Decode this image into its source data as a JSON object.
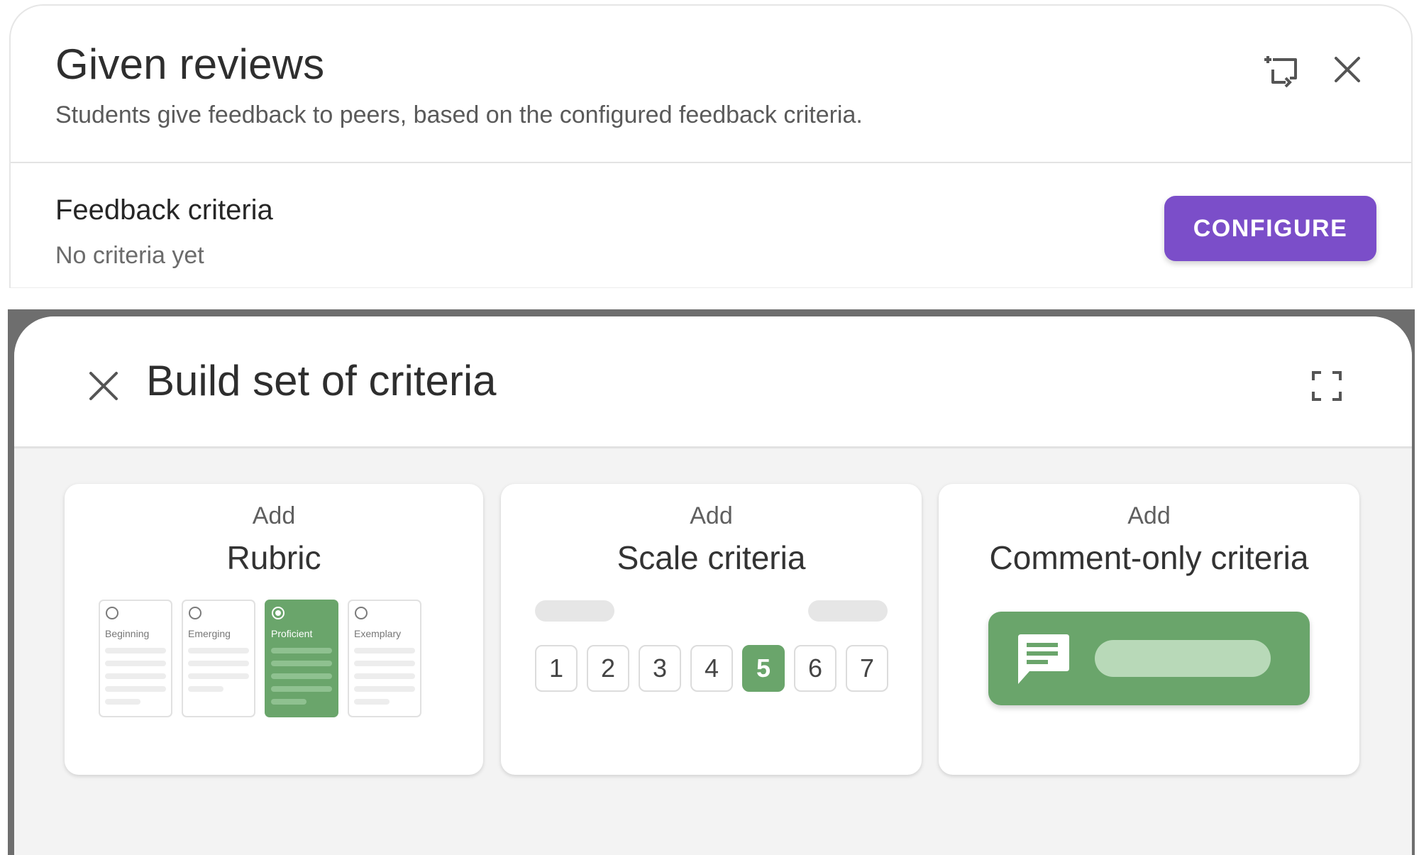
{
  "given_reviews": {
    "title": "Given reviews",
    "subtitle": "Students give feedback to peers, based on the configured feedback criteria.",
    "criteria_heading": "Feedback criteria",
    "criteria_status": "No criteria yet",
    "configure_label": "CONFIGURE",
    "icons": {
      "add_to": "add-to-icon",
      "close": "close-icon"
    },
    "colors": {
      "button": "#7b4ec9"
    }
  },
  "dialog": {
    "title": "Build set of criteria",
    "icons": {
      "close": "close-icon",
      "fullscreen": "fullscreen-icon"
    },
    "cards": {
      "rubric": {
        "kicker": "Add",
        "title": "Rubric",
        "levels": [
          "Beginning",
          "Emerging",
          "Proficient",
          "Exemplary"
        ],
        "selected_level": "Proficient"
      },
      "scale": {
        "kicker": "Add",
        "title": "Scale criteria",
        "values": [
          "1",
          "2",
          "3",
          "4",
          "5",
          "6",
          "7"
        ],
        "selected_value": "5"
      },
      "comment": {
        "kicker": "Add",
        "title": "Comment-only criteria",
        "icon": "comment-icon"
      }
    },
    "colors": {
      "accent": "#6aa56b",
      "backdrop": "#6e6e6e",
      "surface": "#f3f3f3"
    }
  }
}
